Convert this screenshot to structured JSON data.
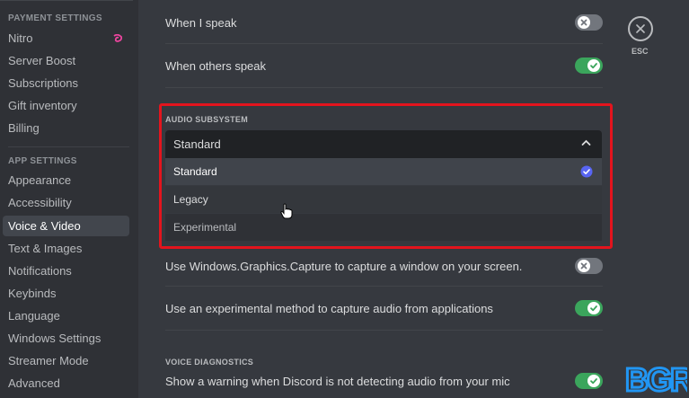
{
  "sidebar": {
    "payment_header": "PAYMENT SETTINGS",
    "payment_items": [
      "Nitro",
      "Server Boost",
      "Subscriptions",
      "Gift inventory",
      "Billing"
    ],
    "app_header": "APP SETTINGS",
    "app_items": [
      "Appearance",
      "Accessibility",
      "Voice & Video",
      "Text & Images",
      "Notifications",
      "Keybinds",
      "Language",
      "Windows Settings",
      "Streamer Mode",
      "Advanced"
    ],
    "selected": "Voice & Video"
  },
  "settings": {
    "when_i_speak": "When I speak",
    "when_others_speak": "When others speak",
    "audio_subsystem_title": "AUDIO SUBSYSTEM",
    "audio_subsystem_value": "Standard",
    "audio_options": [
      "Standard",
      "Legacy",
      "Experimental"
    ],
    "graphics_capture": "Use Windows.Graphics.Capture to capture a window on your screen.",
    "experimental_capture": "Use an experimental method to capture audio from applications",
    "voice_diag_title": "VOICE DIAGNOSTICS",
    "voice_diag_warning": "Show a warning when Discord is not detecting audio from your mic"
  },
  "close": {
    "esc_label": "ESC"
  },
  "watermark": "BGR",
  "colors": {
    "accent": "#5865f2",
    "toggle_on": "#3ba55c",
    "toggle_off": "#72767d",
    "highlight": "#e3141d",
    "nitro": "#eb459e"
  }
}
